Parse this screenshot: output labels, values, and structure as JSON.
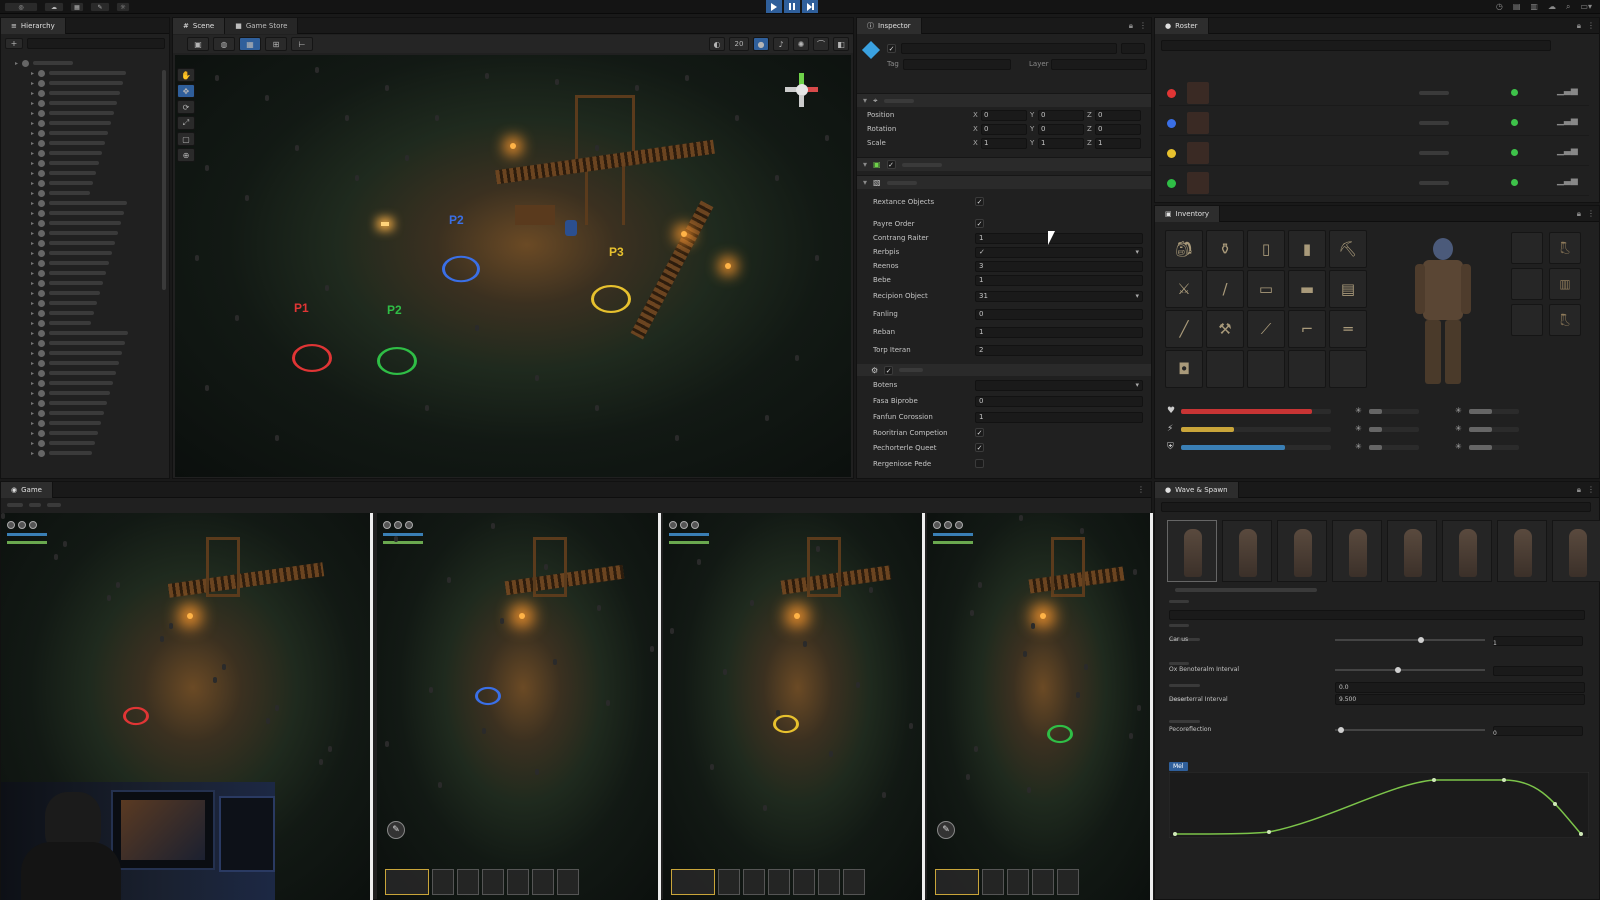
{
  "toolbar": {
    "account_label": "◎",
    "play_icon": "play-icon",
    "pause_icon": "pause-icon",
    "step_icon": "step-icon"
  },
  "hierarchy": {
    "tab": "Hierarchy"
  },
  "scene": {
    "tabs": [
      "Scene",
      "Game Store"
    ],
    "zoom_value": "20",
    "players": [
      {
        "label": "P1",
        "color": "#e03535"
      },
      {
        "label": "P2",
        "color": "#3a6fe6"
      },
      {
        "label": "P2",
        "color": "#2fbe46"
      },
      {
        "label": "P3",
        "color": "#e7c12e"
      }
    ]
  },
  "inspector": {
    "tab": "Inspector",
    "tag_label": "Tag",
    "layer_label": "Layer",
    "transform": {
      "rows": [
        {
          "label": "Position",
          "x": "0",
          "y": "0",
          "z": "0"
        },
        {
          "label": "Rotation",
          "x": "0",
          "y": "0",
          "z": "0"
        },
        {
          "label": "Scale",
          "x": "1",
          "y": "1",
          "z": "1"
        }
      ],
      "axis_x": "X",
      "axis_y": "Y",
      "axis_z": "Z"
    },
    "fields": [
      {
        "label": "Rextance Objects",
        "value": "✓",
        "kind": "check"
      },
      {
        "label": "Payre Order",
        "value": "✓",
        "kind": "check"
      },
      {
        "label": "Contrang Raiter",
        "value": "1",
        "kind": "text"
      },
      {
        "label": "Rerbpis",
        "value": "✓",
        "kind": "dropdown"
      },
      {
        "label": "Reenos",
        "value": "3",
        "kind": "text"
      },
      {
        "label": "Bebe",
        "value": "1",
        "kind": "text"
      },
      {
        "label": "Recipion Object",
        "value": "31",
        "kind": "dropdown"
      },
      {
        "label": "Fanling",
        "value": "0",
        "kind": "text"
      },
      {
        "label": "Reban",
        "value": "1",
        "kind": "text"
      },
      {
        "label": "Torp Iteran",
        "value": "2",
        "kind": "text"
      },
      {
        "label": "Botens",
        "value": "",
        "kind": "dropdown"
      },
      {
        "label": "Fasa Biprobe",
        "value": "0",
        "kind": "text"
      },
      {
        "label": "Fanfun Corossion",
        "value": "1",
        "kind": "text"
      },
      {
        "label": "Rooritrian Competion",
        "value": "✓",
        "kind": "check"
      },
      {
        "label": "Pechorterle Queet",
        "value": "✓",
        "kind": "check"
      },
      {
        "label": "Rergeniose Pede",
        "value": "",
        "kind": "check"
      }
    ]
  },
  "roster": {
    "tab": "Roster",
    "players": [
      {
        "color": "#e03535"
      },
      {
        "color": "#3a6fe6"
      },
      {
        "color": "#e7c12e"
      },
      {
        "color": "#2fbe46"
      }
    ]
  },
  "inventory": {
    "tab": "Inventory",
    "items": [
      "backpack-icon",
      "bottle-icon",
      "canister-icon",
      "can-icon",
      "pickaxe-icon",
      "knife-icon",
      "stick-icon",
      "bandage-icon",
      "plank-icon",
      "note-icon",
      "rifle-icon",
      "axe-icon",
      "bat-icon",
      "pistol-icon",
      "shotgun-icon",
      "pouch-icon",
      "",
      "",
      "",
      ""
    ],
    "equipment": [
      "head-slot",
      "boots-icon",
      "weapon-slot",
      "pants-icon",
      "",
      "boots-icon"
    ],
    "stats": [
      {
        "icon": "heart-icon",
        "color": "#c83434",
        "level": 0.87
      },
      {
        "icon": "bolt-icon",
        "color": "#c9a53a",
        "level": 0.35
      },
      {
        "icon": "shield-icon",
        "color": "#3a7fb5",
        "level": 0.69
      }
    ]
  },
  "game_views": {
    "tab": "Game"
  },
  "wave_panel": {
    "tab": "Wave & Spawn",
    "param_labels": [
      "Car us",
      "Ox Benoteralm Interval",
      "Deserterral Interval",
      "Pecoreflection"
    ],
    "values": [
      "0.0",
      "9.500",
      "0",
      "1"
    ],
    "curve_tag": "Mel"
  }
}
